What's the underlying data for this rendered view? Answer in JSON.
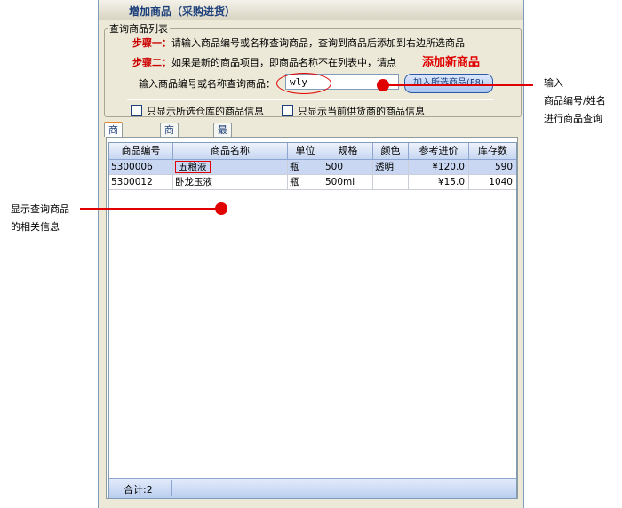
{
  "window": {
    "title": "增加商品（采购进货）"
  },
  "query_group": {
    "legend": "查询商品列表",
    "step1_label": "步骤一：",
    "step1_text": "请输入商品编号或名称查询商品，查询到商品后添加到右边所选商品",
    "step2_label": "步骤二：",
    "step2_text": "如果是新的商品项目，即商品名称不在列表中，请点",
    "add_new_link": "添加新商品",
    "search_label": "输入商品编号或名称查询商品：",
    "search_value": "wly",
    "add_selected_button": "加入所选商品(F8)",
    "checkbox_warehouse": "只显示所选仓库的商品信息",
    "checkbox_supplier": "只显示当前供货商的商品信息"
  },
  "tabs": [
    "商品清单",
    "商品列表",
    "最近进货"
  ],
  "table": {
    "columns": [
      "商品编号",
      "商品名称",
      "单位",
      "规格",
      "颜色",
      "参考进价",
      "库存数"
    ],
    "rows": [
      [
        "5300006",
        "五粮液",
        "瓶",
        "500",
        "透明",
        "¥120.0",
        "590"
      ],
      [
        "5300012",
        "卧龙玉液",
        "瓶",
        "500ml",
        "",
        "¥15.0",
        "1040"
      ]
    ],
    "footer_total": "合计:2"
  },
  "annotations": {
    "right_callout": [
      "输入",
      "商品编号/姓名",
      "进行商品查询"
    ],
    "left_callout": [
      "显示查询商品",
      "的相关信息"
    ]
  },
  "colors": {
    "accent": "#e00000",
    "header_blue": "#c6d6f1",
    "selected_row": "#c9d7f2"
  }
}
